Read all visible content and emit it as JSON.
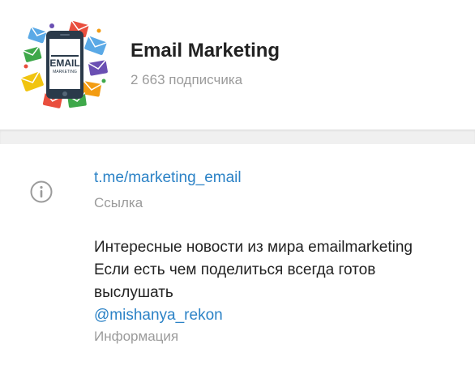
{
  "channel": {
    "title": "Email Marketing",
    "subscribers": "2 663 подписчика",
    "logo": {
      "main_text": "EMAIL",
      "sub_text": "MARKETING"
    }
  },
  "info": {
    "icon": "info-icon",
    "link": "t.me/marketing_email",
    "link_label": "Ссылка",
    "description_lines": [
      "Интересные новости из мира emailmarketing",
      "Если есть чем поделиться всегда готов",
      "выслушать"
    ],
    "mention": "@mishanya_rekon",
    "description_label": "Информация"
  },
  "colors": {
    "link": "#2b82c6",
    "muted": "#9b9b9b",
    "divider": "#f0f0f0"
  }
}
